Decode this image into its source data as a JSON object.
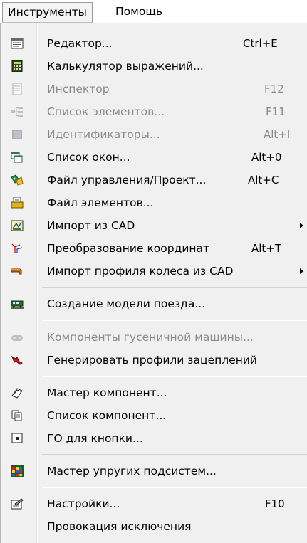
{
  "menubar": {
    "tools": "Инструменты",
    "help": "Помощь"
  },
  "menu": {
    "editor": {
      "label": "Редактор...",
      "shortcut": "Ctrl+E"
    },
    "calculator": {
      "label": "Калькулятор выражений..."
    },
    "inspector": {
      "label": "Инспектор",
      "shortcut": "F12"
    },
    "element_list": {
      "label": "Список элементов...",
      "shortcut": "F11"
    },
    "identifiers": {
      "label": "Идентификаторы...",
      "shortcut": "Alt+I"
    },
    "window_list": {
      "label": "Список окон...",
      "shortcut": "Alt+0"
    },
    "control_file": {
      "label": "Файл управления/Проект...",
      "shortcut": "Alt+C"
    },
    "elements_file": {
      "label": "Файл элементов..."
    },
    "import_cad": {
      "label": "Импорт из CAD"
    },
    "coord_transform": {
      "label": "Преобразование координат",
      "shortcut": "Alt+T"
    },
    "wheel_profile_import": {
      "label": "Импорт профиля колеса из CAD"
    },
    "train_model": {
      "label": "Создание модели поезда..."
    },
    "tracked_components": {
      "label": "Компоненты гусеничной машины..."
    },
    "gear_profiles": {
      "label": "Генерировать профили зацеплений"
    },
    "component_wizard": {
      "label": "Мастер компонент..."
    },
    "component_list": {
      "label": "Список компонент..."
    },
    "button_go": {
      "label": "ГО для кнопки..."
    },
    "elastic_wizard": {
      "label": "Мастер упругих подсистем..."
    },
    "settings": {
      "label": "Настройки...",
      "shortcut": "F10"
    },
    "exception": {
      "label": "Провокация исключения"
    }
  }
}
